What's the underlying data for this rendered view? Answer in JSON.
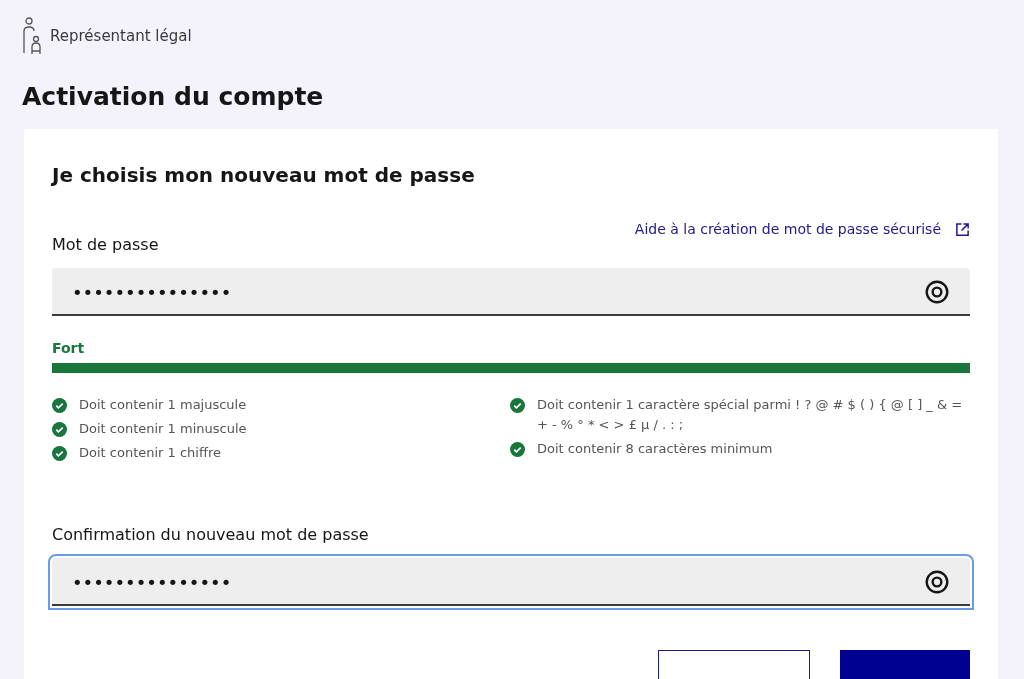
{
  "header": {
    "role": "Représentant légal"
  },
  "page_title": "Activation du compte",
  "card": {
    "heading": "Je choisis mon nouveau mot de passe",
    "help_link": "Aide à la création de mot de passe sécurisé",
    "password": {
      "label": "Mot de passe",
      "value": "•••••••••••••••",
      "focused": false
    },
    "strength": {
      "label": "Fort",
      "level": 1
    },
    "rules": [
      {
        "text": "Doit contenir 1 majuscule",
        "checked": true
      },
      {
        "text": "Doit contenir 1 minuscule",
        "checked": true
      },
      {
        "text": "Doit contenir 1 chiffre",
        "checked": true
      },
      {
        "text": "Doit contenir 1 caractère spécial parmi ! ? @ # $ ( ) { @ [ ] _ & = + - % ° * < > £ µ / . : ;",
        "checked": true
      },
      {
        "text": "Doit contenir 8 caractères minimum",
        "checked": true
      }
    ],
    "confirmation": {
      "label": "Confirmation du nouveau mot de passe",
      "value": "•••••••••••••••",
      "focused": true
    }
  }
}
